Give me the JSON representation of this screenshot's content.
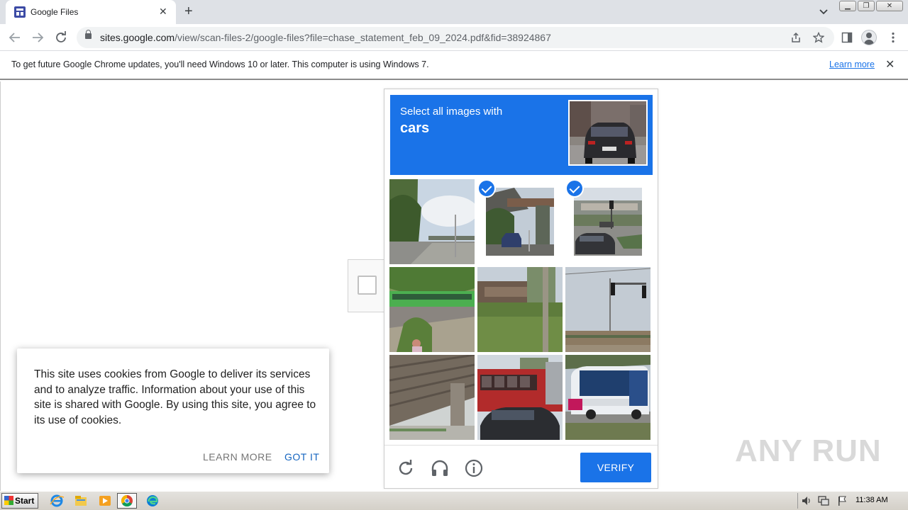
{
  "browser": {
    "tab_title": "Google Files",
    "tab_close": "✕",
    "new_tab": "+",
    "url_host": "sites.google.com",
    "url_path": "/view/scan-files-2/google-files?file=chase_statement_feb_09_2024.pdf&fid=38924867"
  },
  "infobar": {
    "message": "To get future Google Chrome updates, you'll need Windows 10 or later. This computer is using Windows 7.",
    "learn_more": "Learn more",
    "close": "✕"
  },
  "captcha": {
    "instruction": "Select all images with",
    "target": "cars",
    "tiles": [
      {
        "selected": false
      },
      {
        "selected": true
      },
      {
        "selected": true
      },
      {
        "selected": false
      },
      {
        "selected": false
      },
      {
        "selected": false
      },
      {
        "selected": false
      },
      {
        "selected": false
      },
      {
        "selected": false
      }
    ],
    "verify_label": "VERIFY"
  },
  "cookie_notice": {
    "text": "This site uses cookies from Google to deliver its services and to analyze traffic. Information about your use of this site is shared with Google. By using this site, you agree to its use of cookies.",
    "learn_more": "LEARN MORE",
    "got_it": "GOT IT"
  },
  "watermark": "ANY RUN",
  "taskbar": {
    "start": "Start",
    "clock": "11:38 AM"
  },
  "colors": {
    "accent": "#1a73e8",
    "cookie_button": "#1565c0",
    "cookie_secondary": "#757575"
  }
}
